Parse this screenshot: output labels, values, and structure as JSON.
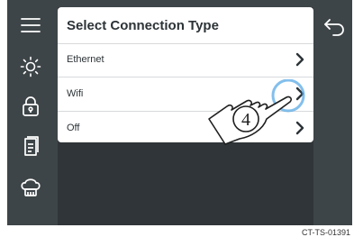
{
  "dialog": {
    "title": "Select Connection Type",
    "options": [
      {
        "label": "Ethernet"
      },
      {
        "label": "Wifi"
      },
      {
        "label": "Off"
      }
    ]
  },
  "annotation": {
    "step": "4"
  },
  "caption": "CT-TS-01391",
  "icons": {
    "menu": "menu-icon",
    "brightness": "brightness-icon",
    "lock": "lock-icon",
    "document": "document-icon",
    "chef": "chef-hat-icon",
    "back": "back-arrow-icon",
    "chevron": "chevron-right-icon"
  },
  "colors": {
    "screen_bg": "#3e4548",
    "panel_bg": "#2f3538",
    "card_bg": "#ffffff",
    "text": "#2c3337",
    "tap_ring": "#5aa9e6"
  }
}
